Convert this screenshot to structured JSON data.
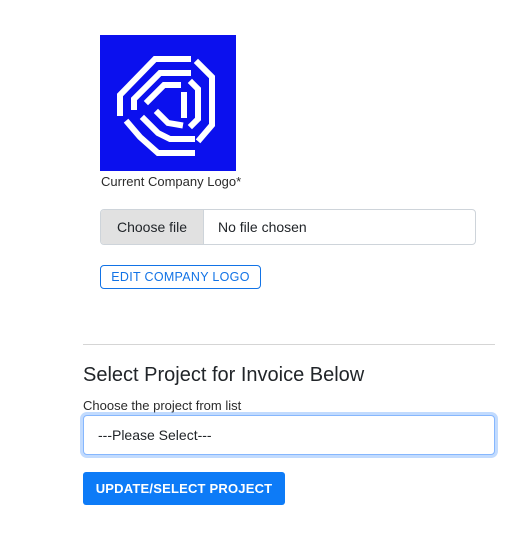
{
  "logo": {
    "caption": "Current Company Logo*",
    "icon": "company-logo-hexagon",
    "background_color": "#0b10ee"
  },
  "file_input": {
    "button_label": "Choose file",
    "status": "No file chosen"
  },
  "edit_logo_button": {
    "label": "EDIT COMPANY LOGO"
  },
  "project_section": {
    "heading": "Select Project for Invoice Below",
    "select_label": "Choose the project from list",
    "select_value": "---Please Select---",
    "update_button_label": "UPDATE/SELECT PROJECT"
  },
  "colors": {
    "accent": "#0d7bf7",
    "outline_accent": "#1273e6"
  }
}
